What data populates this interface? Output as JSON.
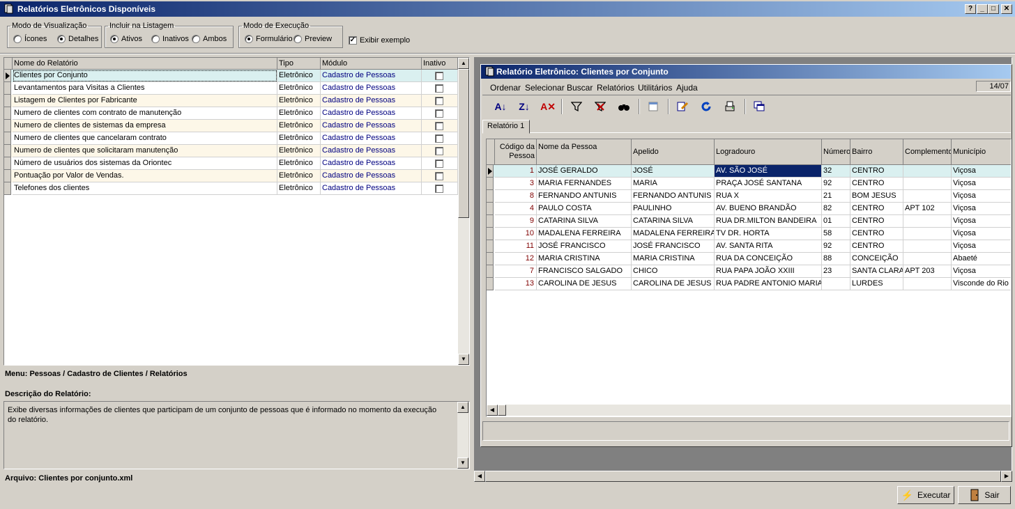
{
  "window": {
    "title": "Relatórios Eletrônicos Disponíveis",
    "help": "?",
    "min": "_",
    "max": "□",
    "close": "✕"
  },
  "options": {
    "view_mode": {
      "legend": "Modo de Visualização",
      "opt1": "Ícones",
      "opt2": "Detalhes",
      "selected": "Detalhes"
    },
    "include": {
      "legend": "Incluir na Listagem",
      "opt1": "Ativos",
      "opt2": "Inativos",
      "opt3": "Ambos",
      "selected": "Ativos"
    },
    "exec_mode": {
      "legend": "Modo de Execução",
      "opt1": "Formulário",
      "opt2": "Preview",
      "selected": "Formulário"
    },
    "show_example": {
      "label": "Exibir exemplo",
      "checked": true
    }
  },
  "reports": {
    "headers": {
      "name": "Nome do Relatório",
      "type": "Tipo",
      "module": "Módulo",
      "inactive": "Inativo"
    },
    "rows": [
      {
        "name": "Clientes por Conjunto",
        "type": "Eletrônico",
        "module": "Cadastro de Pessoas"
      },
      {
        "name": "Levantamentos para Visitas a Clientes",
        "type": "Eletrônico",
        "module": "Cadastro de Pessoas"
      },
      {
        "name": "Listagem de Clientes por Fabricante",
        "type": "Eletrônico",
        "module": "Cadastro de Pessoas"
      },
      {
        "name": "Numero de clientes com contrato de manutenção",
        "type": "Eletrônico",
        "module": "Cadastro de Pessoas"
      },
      {
        "name": "Numero de clientes de sistemas da empresa",
        "type": "Eletrônico",
        "module": "Cadastro de Pessoas"
      },
      {
        "name": "Numero de clientes que cancelaram contrato",
        "type": "Eletrônico",
        "module": "Cadastro de Pessoas"
      },
      {
        "name": "Numero de clientes que solicitaram manutenção",
        "type": "Eletrônico",
        "module": "Cadastro de Pessoas"
      },
      {
        "name": "Número de usuários dos sistemas da Oriontec",
        "type": "Eletrônico",
        "module": "Cadastro de Pessoas"
      },
      {
        "name": "Pontuação por Valor de Vendas.",
        "type": "Eletrônico",
        "module": "Cadastro de Pessoas"
      },
      {
        "name": "Telefones dos clientes",
        "type": "Eletrônico",
        "module": "Cadastro de Pessoas"
      }
    ]
  },
  "menu_path": "Menu: Pessoas / Cadastro de Clientes / Relatórios",
  "description": {
    "label": "Descrição do Relatório:",
    "text": "Exibe diversas informações de clientes que participam de um conjunto de pessoas que é informado no momento da execução do relatório."
  },
  "file": "Arquivo: Clientes por conjunto.xml",
  "preview": {
    "title": "Relatório Eletrônico: Clientes por Conjunto",
    "menu": [
      "Ordenar",
      "Selecionar",
      "Buscar",
      "Relatórios",
      "Utilitários",
      "Ajuda"
    ],
    "date": "14/07",
    "tab": "Relatório 1",
    "headers": {
      "code": "Código da Pessoa",
      "name": "Nome da Pessoa",
      "nick": "Apelido",
      "street": "Logradouro",
      "number": "Número",
      "district": "Bairro",
      "complement": "Complemento",
      "city": "Município"
    },
    "rows": [
      {
        "code": "1",
        "name": "JOSÉ GERALDO",
        "nick": "JOSÉ",
        "street": "AV. SÃO JOSÉ",
        "number": "32",
        "district": "CENTRO",
        "complement": "",
        "city": "Viçosa"
      },
      {
        "code": "3",
        "name": "MARIA FERNANDES",
        "nick": "MARIA",
        "street": "PRAÇA JOSÉ SANTANA",
        "number": "92",
        "district": "CENTRO",
        "complement": "",
        "city": "Viçosa"
      },
      {
        "code": "8",
        "name": "FERNANDO ANTUNIS",
        "nick": "FERNANDO ANTUNIS",
        "street": "RUA X",
        "number": "21",
        "district": "BOM JESUS",
        "complement": "",
        "city": "Viçosa"
      },
      {
        "code": "4",
        "name": "PAULO COSTA",
        "nick": "PAULINHO",
        "street": "AV. BUENO BRANDÃO",
        "number": "82",
        "district": "CENTRO",
        "complement": "APT 102",
        "city": "Viçosa"
      },
      {
        "code": "9",
        "name": "CATARINA SILVA",
        "nick": "CATARINA SILVA",
        "street": "RUA DR.MILTON BANDEIRA",
        "number": "01",
        "district": "CENTRO",
        "complement": "",
        "city": "Viçosa"
      },
      {
        "code": "10",
        "name": "MADALENA FERREIRA",
        "nick": "MADALENA FERREIRA",
        "street": "TV DR. HORTA",
        "number": "58",
        "district": "CENTRO",
        "complement": "",
        "city": "Viçosa"
      },
      {
        "code": "11",
        "name": "JOSÉ FRANCISCO",
        "nick": "JOSÉ FRANCISCO",
        "street": "AV. SANTA RITA",
        "number": "92",
        "district": "CENTRO",
        "complement": "",
        "city": "Viçosa"
      },
      {
        "code": "12",
        "name": "MARIA CRISTINA",
        "nick": "MARIA CRISTINA",
        "street": "RUA DA CONCEIÇÃO",
        "number": "88",
        "district": "CONCEIÇÃO",
        "complement": "",
        "city": "Abaeté"
      },
      {
        "code": "7",
        "name": "FRANCISCO SALGADO",
        "nick": "CHICO",
        "street": "RUA PAPA JOÃO XXIII",
        "number": "23",
        "district": "SANTA CLARA",
        "complement": "APT 203",
        "city": "Viçosa"
      },
      {
        "code": "13",
        "name": "CAROLINA DE JESUS",
        "nick": "CAROLINA DE JESUS",
        "street": "RUA PADRE ANTONIO MARIA",
        "number": "",
        "district": "LURDES",
        "complement": "",
        "city": "Visconde do Rio B"
      }
    ]
  },
  "buttons": {
    "execute": "Executar",
    "exit": "Sair"
  },
  "colors": {
    "title_start": "#0a246a",
    "title_end": "#a6caf0",
    "selected_row": "#daf0f0",
    "alt_row": "#fdf7e8",
    "module_text": "#000080",
    "code_text": "#800000"
  }
}
